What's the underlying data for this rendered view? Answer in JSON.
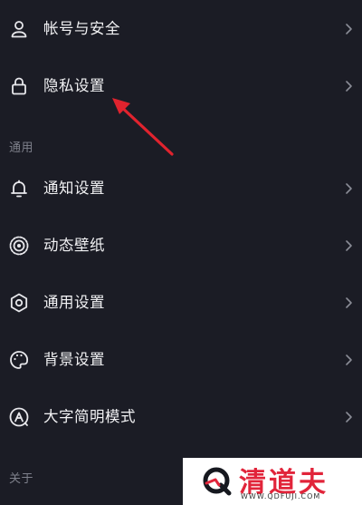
{
  "menu_top": [
    {
      "label": "帐号与安全",
      "icon": "user-icon"
    },
    {
      "label": "隐私设置",
      "icon": "lock-icon"
    }
  ],
  "section_general": "通用",
  "menu_general": [
    {
      "label": "通知设置",
      "icon": "bell-icon"
    },
    {
      "label": "动态壁纸",
      "icon": "wallpaper-icon"
    },
    {
      "label": "通用设置",
      "icon": "gear-icon"
    },
    {
      "label": "背景设置",
      "icon": "palette-icon"
    },
    {
      "label": "大字简明模式",
      "icon": "font-size-icon"
    }
  ],
  "section_about": "关于",
  "watermark": {
    "title": "清道夫",
    "url": "WWW.QDFUJI.COM",
    "accent": "#e1243a"
  },
  "colors": {
    "background": "#1b1c25",
    "text": "#f2f2f4",
    "section": "#7e808b",
    "arrow": "#e0232e"
  }
}
